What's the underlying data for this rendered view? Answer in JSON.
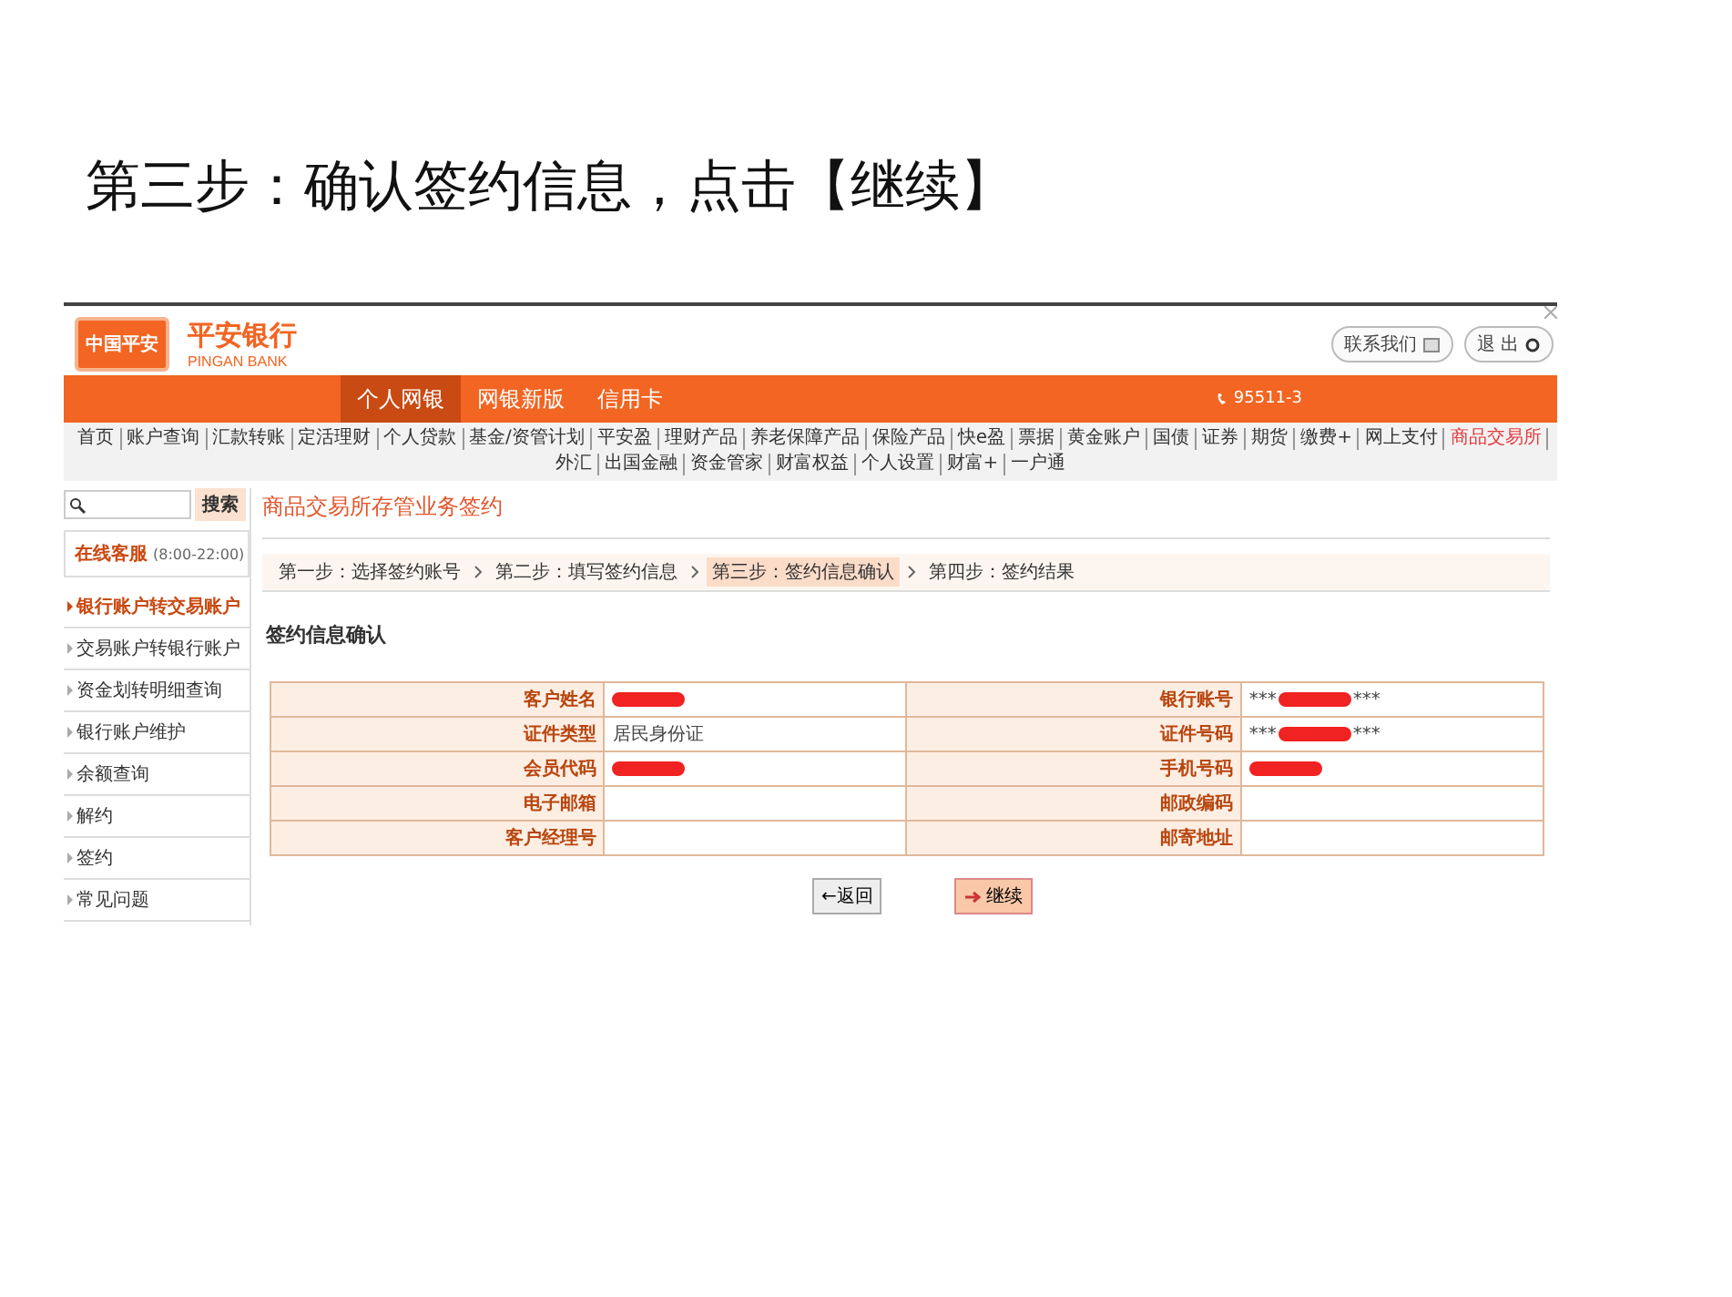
{
  "slide_title": "第三步：确认签约信息，点击【继续】",
  "header": {
    "logo_text": "中国平安",
    "bank_name": "平安银行",
    "bank_name_en": "PINGAN BANK",
    "contact_button": "联系我们",
    "logout_button": "退 出"
  },
  "main_tabs": [
    {
      "label": "个人网银",
      "selected": true
    },
    {
      "label": "网银新版",
      "selected": false
    },
    {
      "label": "信用卡",
      "selected": false
    }
  ],
  "hotline": "95511-3",
  "nav_items": [
    {
      "label": "首页",
      "selected": false
    },
    {
      "label": "账户查询",
      "selected": false
    },
    {
      "label": "汇款转账",
      "selected": false
    },
    {
      "label": "定活理财",
      "selected": false
    },
    {
      "label": "个人贷款",
      "selected": false
    },
    {
      "label": "基金/资管计划",
      "selected": false
    },
    {
      "label": "平安盈",
      "selected": false
    },
    {
      "label": "理财产品",
      "selected": false
    },
    {
      "label": "养老保障产品",
      "selected": false
    },
    {
      "label": "保险产品",
      "selected": false
    },
    {
      "label": "快e盈",
      "selected": false
    },
    {
      "label": "票据",
      "selected": false
    },
    {
      "label": "黄金账户",
      "selected": false
    },
    {
      "label": "国债",
      "selected": false
    },
    {
      "label": "证券",
      "selected": false
    },
    {
      "label": "期货",
      "selected": false
    },
    {
      "label": "缴费+",
      "selected": false
    },
    {
      "label": "网上支付",
      "selected": false
    },
    {
      "label": "商品交易所",
      "selected": true
    },
    {
      "label": "外汇",
      "selected": false
    },
    {
      "label": "出国金融",
      "selected": false
    },
    {
      "label": "资金管家",
      "selected": false
    },
    {
      "label": "财富权益",
      "selected": false
    },
    {
      "label": "个人设置",
      "selected": false
    },
    {
      "label": "财富+",
      "selected": false
    },
    {
      "label": "一户通",
      "selected": false
    }
  ],
  "sidebar": {
    "search_button": "搜索",
    "online_service": "在线客服",
    "service_hours": "(8:00-22:00)",
    "items": [
      {
        "label": "银行账户转交易账户",
        "selected": true
      },
      {
        "label": "交易账户转银行账户",
        "selected": false
      },
      {
        "label": "资金划转明细查询",
        "selected": false
      },
      {
        "label": "银行账户维护",
        "selected": false
      },
      {
        "label": "余额查询",
        "selected": false
      },
      {
        "label": "解约",
        "selected": false
      },
      {
        "label": "签约",
        "selected": false
      },
      {
        "label": "常见问题",
        "selected": false
      }
    ]
  },
  "page_title": "商品交易所存管业务签约",
  "steps": [
    {
      "label": "第一步：选择签约账号",
      "selected": false
    },
    {
      "label": "第二步：填写签约信息",
      "selected": false
    },
    {
      "label": "第三步：签约信息确认",
      "selected": true
    },
    {
      "label": "第四步：签约结果",
      "selected": false
    }
  ],
  "section_title": "签约信息确认",
  "fields": [
    {
      "label": "客户姓名",
      "redacted": true
    },
    {
      "label": "银行账号",
      "value": "***",
      "redacted": true,
      "value_end": "***"
    },
    {
      "label": "证件类型",
      "value": "居民身份证",
      "redacted": false
    },
    {
      "label": "证件号码",
      "value": "***",
      "redacted": true,
      "value_end": "***"
    },
    {
      "label": "会员代码",
      "redacted": true
    },
    {
      "label": "手机号码",
      "redacted": true
    },
    {
      "label": "电子邮箱",
      "redacted": false
    },
    {
      "label": "邮政编码",
      "redacted": false
    },
    {
      "label": "客户经理号",
      "redacted": false
    },
    {
      "label": "邮寄地址",
      "redacted": false
    }
  ],
  "buttons": {
    "back": "←返回",
    "continue": "继续"
  }
}
